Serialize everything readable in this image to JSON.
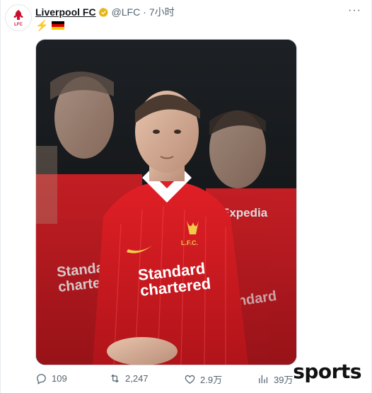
{
  "tweet": {
    "author_name": "Liverpool FC",
    "handle": "@LFC",
    "separator": "·",
    "time": "7小时",
    "text_emoji": "⚡",
    "more_label": "···",
    "avatar_text": "LFC"
  },
  "photo": {
    "sponsor_line1": "Standard",
    "sponsor_line2": "chartered",
    "crest_text": "L.F.C.",
    "sleeve_text": "Expedia"
  },
  "actions": {
    "replies": "109",
    "retweets": "2,247",
    "likes": "2.9万",
    "views": "39万"
  },
  "watermark": "sports",
  "colors": {
    "kit_red": "#c8102e",
    "verified_gold": "#e2b719",
    "muted": "#536471"
  }
}
